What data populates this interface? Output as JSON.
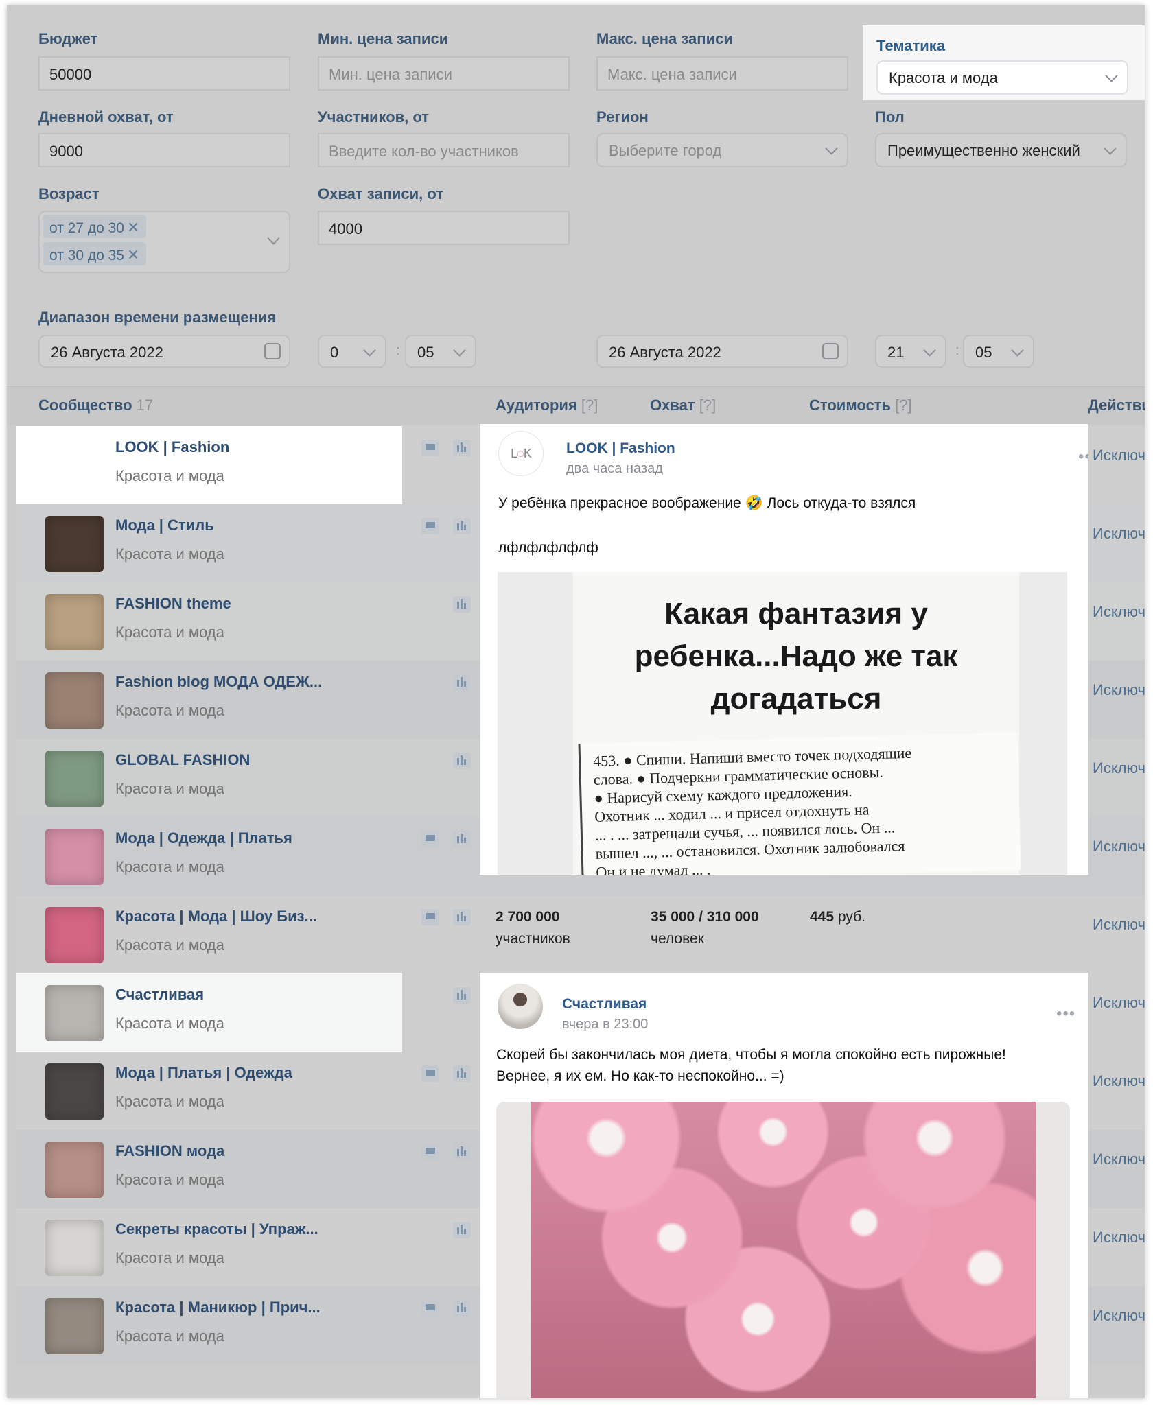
{
  "filters": {
    "budget": {
      "label": "Бюджет",
      "value": "50000"
    },
    "min_price": {
      "label": "Мин. цена записи",
      "placeholder": "Мин. цена записи"
    },
    "max_price": {
      "label": "Макс. цена записи",
      "placeholder": "Макс. цена записи"
    },
    "topic": {
      "label": "Тематика",
      "value": "Красота и мода"
    },
    "daily_reach": {
      "label": "Дневной охват, от",
      "value": "9000"
    },
    "members": {
      "label": "Участников, от",
      "placeholder": "Введите кол-во участников"
    },
    "region": {
      "label": "Регион",
      "placeholder": "Выберите город"
    },
    "gender": {
      "label": "Пол",
      "value": "Преимущественно женский"
    },
    "age": {
      "label": "Возраст",
      "chips": [
        "от 27 до 30",
        "от 30 до 35"
      ],
      "remove_glyph": "✕"
    },
    "post_reach": {
      "label": "Охват записи, от",
      "value": "4000"
    },
    "time_range": {
      "label": "Диапазон времени размещения",
      "from_date": "26 Августа  2022",
      "from_hour": "0",
      "from_min": "05",
      "to_date": "26 Августа  2022",
      "to_hour": "21",
      "to_min": "05",
      "separator": ":"
    }
  },
  "table": {
    "header": {
      "community": "Сообщество",
      "count": "17",
      "audience": "Аудитория",
      "reach": "Охват",
      "cost": "Стоимость",
      "hint": "[?]",
      "actions": "Действия"
    },
    "exclude_label": "Исключить",
    "rows": [
      {
        "name": "LOOK | Fashion",
        "category": "Красота и мода",
        "comments": true,
        "highlight": true,
        "avatar_color": "#ffffff"
      },
      {
        "name": "Мода | Стиль",
        "category": "Красота и мода",
        "comments": true,
        "avatar_color": "#4a3a30"
      },
      {
        "name": "FASHION theme",
        "category": "Красота и мода",
        "comments": false,
        "avatar_color": "#b8a080"
      },
      {
        "name": "Fashion blog МОДА ОДЕЖ...",
        "category": "Красота и мода",
        "comments": false,
        "avatar_color": "#9a8272"
      },
      {
        "name": "GLOBAL FASHION",
        "category": "Красота и мода",
        "comments": false,
        "avatar_color": "#7f9a82"
      },
      {
        "name": "Мода | Одежда | Платья",
        "category": "Красота и мода",
        "comments": true,
        "avatar_color": "#d58fa6"
      },
      {
        "name": "Красота | Мода | Шоу Биз...",
        "category": "Красота и мода",
        "comments": true,
        "avatar_color": "#d36582",
        "stats": {
          "audience": "2 700 000",
          "audience_unit": "участников",
          "reach": "35 000 / 310 000",
          "reach_unit": "человек",
          "cost": "445",
          "cost_unit": "руб."
        }
      },
      {
        "name": "Счастливая",
        "category": "Красота и мода",
        "comments": false,
        "highlight": true,
        "avatar_color": "#b8b4b0"
      },
      {
        "name": "Мода | Платья | Одежда",
        "category": "Красота и мода",
        "comments": true,
        "avatar_color": "#4a4646"
      },
      {
        "name": "FASHION мода",
        "category": "Красота и мода",
        "comments": true,
        "avatar_color": "#b68f86"
      },
      {
        "name": "Секреты красоты | Упраж...",
        "category": "Красота и мода",
        "comments": false,
        "avatar_color": "#d8d6d2"
      },
      {
        "name": "Красота | Маникюр | Прич...",
        "category": "Красота и мода",
        "comments": true,
        "avatar_color": "#948a80"
      }
    ]
  },
  "post1": {
    "author": "LOOK | Fashion",
    "time": "два часа назад",
    "avatar_logo": "LOOK FASHION",
    "text": "У ребёнка прекрасное воображение 🤣 Лось откуда-то взялся",
    "text2": "лфлфлфлфлф",
    "image_title": "Какая фантазия у ребенка...Надо же так догадаться",
    "image_lines": [
      "453. ● Спиши. Напиши вместо точек подходящие",
      "слова. ● Подчеркни грамматические основы.",
      "● Нарисуй схему каждого предложения.",
      "Охотник ... ходил ... и присел отдохнуть на",
      "... . ... затрещали сучья, ... появился лось. Он ...",
      "вышел ..., ... остановился. Охотник залюбовался",
      "Он и не думал ... ."
    ],
    "menu": "•••"
  },
  "post2": {
    "author": "Счастливая",
    "time": "вчера в 23:00",
    "text": "Скорей бы закончилась моя диета, чтобы я могла спокойно есть пирожные!",
    "text2": "Вернее, я их ем. Но как-то неспокойно... =)",
    "menu": "•••"
  }
}
